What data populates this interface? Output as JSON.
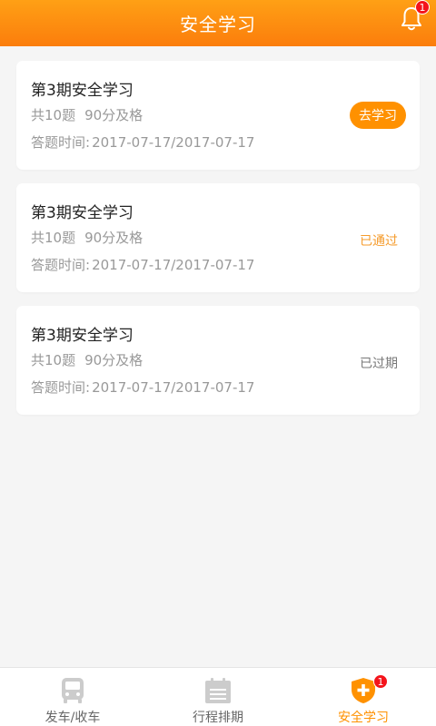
{
  "header": {
    "title": "安全学习",
    "notification_count": "1"
  },
  "cards": [
    {
      "title": "第3期安全学习",
      "questions": "共10题",
      "pass_score": "90分及格",
      "time_label": "答题时间:",
      "time_range": "2017-07-17/2017-07-17",
      "status": "去学习"
    },
    {
      "title": "第3期安全学习",
      "questions": "共10题",
      "pass_score": "90分及格",
      "time_label": "答题时间:",
      "time_range": "2017-07-17/2017-07-17",
      "status": "已通过"
    },
    {
      "title": "第3期安全学习",
      "questions": "共10题",
      "pass_score": "90分及格",
      "time_label": "答题时间:",
      "time_range": "2017-07-17/2017-07-17",
      "status": "已过期"
    }
  ],
  "tabs": [
    {
      "label": "发车/收车",
      "icon": "bus-icon",
      "active": false
    },
    {
      "label": "行程排期",
      "icon": "calendar-icon",
      "active": false
    },
    {
      "label": "安全学习",
      "icon": "shield-plus-icon",
      "active": true,
      "badge": "1"
    }
  ],
  "colors": {
    "accent": "#ff9100",
    "passed": "#f59b2b",
    "expired": "#777777",
    "tab_inactive": "#666666",
    "tab_icon_inactive": "#cccccc"
  }
}
